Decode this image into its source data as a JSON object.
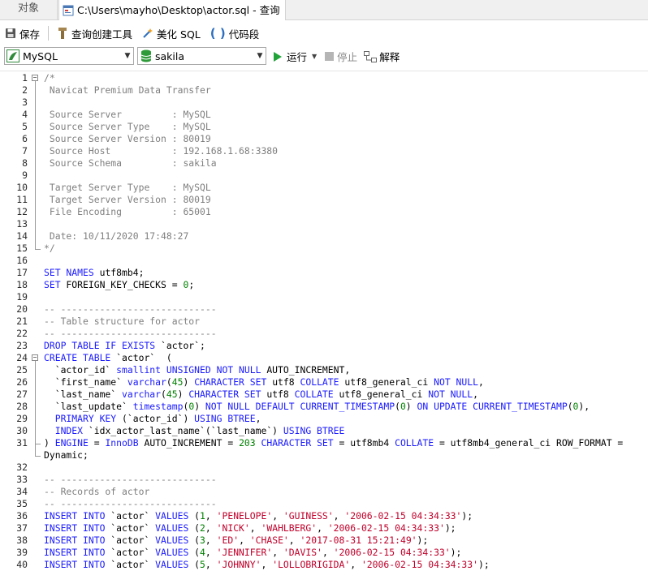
{
  "tabs": {
    "objects": "对象",
    "file": "C:\\Users\\mayho\\Desktop\\actor.sql - 查询"
  },
  "toolbar": {
    "save": "保存",
    "query_builder": "查询创建工具",
    "beautify": "美化 SQL",
    "snippet": "代码段"
  },
  "selectors": {
    "connection": "MySQL",
    "database": "sakila",
    "run": "运行",
    "stop": "停止",
    "explain": "解释"
  },
  "colors": {
    "comment": "#7f7f7f",
    "keyword": "#1a1aff",
    "string": "#c0002a",
    "number": "#008000"
  },
  "code_lines": [
    {
      "n": "1",
      "tokens": [
        [
          "c",
          "/*"
        ]
      ]
    },
    {
      "n": "2",
      "tokens": [
        [
          "c",
          " Navicat Premium Data Transfer"
        ]
      ]
    },
    {
      "n": "3",
      "tokens": []
    },
    {
      "n": "4",
      "tokens": [
        [
          "c",
          " Source Server         : MySQL"
        ]
      ]
    },
    {
      "n": "5",
      "tokens": [
        [
          "c",
          " Source Server Type    : MySQL"
        ]
      ]
    },
    {
      "n": "6",
      "tokens": [
        [
          "c",
          " Source Server Version : 80019"
        ]
      ]
    },
    {
      "n": "7",
      "tokens": [
        [
          "c",
          " Source Host           : 192.168.1.68:3380"
        ]
      ]
    },
    {
      "n": "8",
      "tokens": [
        [
          "c",
          " Source Schema         : sakila"
        ]
      ]
    },
    {
      "n": "9",
      "tokens": []
    },
    {
      "n": "10",
      "tokens": [
        [
          "c",
          " Target Server Type    : MySQL"
        ]
      ]
    },
    {
      "n": "11",
      "tokens": [
        [
          "c",
          " Target Server Version : 80019"
        ]
      ]
    },
    {
      "n": "12",
      "tokens": [
        [
          "c",
          " File Encoding         : 65001"
        ]
      ]
    },
    {
      "n": "13",
      "tokens": []
    },
    {
      "n": "14",
      "tokens": [
        [
          "c",
          " Date: 10/11/2020 17:48:27"
        ]
      ]
    },
    {
      "n": "15",
      "tokens": [
        [
          "c",
          "*/"
        ]
      ]
    },
    {
      "n": "16",
      "tokens": []
    },
    {
      "n": "17",
      "tokens": [
        [
          "k",
          "SET NAMES"
        ],
        [
          "t",
          " utf8mb4;"
        ]
      ]
    },
    {
      "n": "18",
      "tokens": [
        [
          "k",
          "SET"
        ],
        [
          "t",
          " FOREIGN_KEY_CHECKS = "
        ],
        [
          "n",
          "0"
        ],
        [
          "t",
          ";"
        ]
      ]
    },
    {
      "n": "19",
      "tokens": []
    },
    {
      "n": "20",
      "tokens": [
        [
          "c",
          "-- ----------------------------"
        ]
      ]
    },
    {
      "n": "21",
      "tokens": [
        [
          "c",
          "-- Table structure for actor"
        ]
      ]
    },
    {
      "n": "22",
      "tokens": [
        [
          "c",
          "-- ----------------------------"
        ]
      ]
    },
    {
      "n": "23",
      "tokens": [
        [
          "k",
          "DROP TABLE IF EXISTS"
        ],
        [
          "t",
          " `actor`;"
        ]
      ]
    },
    {
      "n": "24",
      "tokens": [
        [
          "k",
          "CREATE TABLE"
        ],
        [
          "t",
          " `actor`  ("
        ]
      ]
    },
    {
      "n": "25",
      "tokens": [
        [
          "t",
          "  `actor_id` "
        ],
        [
          "k",
          "smallint UNSIGNED NOT NULL"
        ],
        [
          "t",
          " AUTO_INCREMENT,"
        ]
      ]
    },
    {
      "n": "26",
      "tokens": [
        [
          "t",
          "  `first_name` "
        ],
        [
          "k",
          "varchar"
        ],
        [
          "t",
          "("
        ],
        [
          "n",
          "45"
        ],
        [
          "t",
          ") "
        ],
        [
          "k",
          "CHARACTER SET"
        ],
        [
          "t",
          " utf8 "
        ],
        [
          "k",
          "COLLATE"
        ],
        [
          "t",
          " utf8_general_ci "
        ],
        [
          "k",
          "NOT NULL"
        ],
        [
          "t",
          ","
        ]
      ]
    },
    {
      "n": "27",
      "tokens": [
        [
          "t",
          "  `last_name` "
        ],
        [
          "k",
          "varchar"
        ],
        [
          "t",
          "("
        ],
        [
          "n",
          "45"
        ],
        [
          "t",
          ") "
        ],
        [
          "k",
          "CHARACTER SET"
        ],
        [
          "t",
          " utf8 "
        ],
        [
          "k",
          "COLLATE"
        ],
        [
          "t",
          " utf8_general_ci "
        ],
        [
          "k",
          "NOT NULL"
        ],
        [
          "t",
          ","
        ]
      ]
    },
    {
      "n": "28",
      "tokens": [
        [
          "t",
          "  `last_update` "
        ],
        [
          "k",
          "timestamp"
        ],
        [
          "t",
          "("
        ],
        [
          "n",
          "0"
        ],
        [
          "t",
          ") "
        ],
        [
          "k",
          "NOT NULL DEFAULT CURRENT_TIMESTAMP"
        ],
        [
          "t",
          "("
        ],
        [
          "n",
          "0"
        ],
        [
          "t",
          ") "
        ],
        [
          "k",
          "ON UPDATE CURRENT_TIMESTAMP"
        ],
        [
          "t",
          "("
        ],
        [
          "n",
          "0"
        ],
        [
          "t",
          "),"
        ]
      ]
    },
    {
      "n": "29",
      "tokens": [
        [
          "k",
          "  PRIMARY KEY"
        ],
        [
          "t",
          " (`actor_id`) "
        ],
        [
          "k",
          "USING BTREE"
        ],
        [
          "t",
          ","
        ]
      ]
    },
    {
      "n": "30",
      "tokens": [
        [
          "k",
          "  INDEX"
        ],
        [
          "t",
          " `idx_actor_last_name`(`last_name`) "
        ],
        [
          "k",
          "USING BTREE"
        ]
      ]
    },
    {
      "n": "31",
      "tokens": [
        [
          "t",
          ") "
        ],
        [
          "k",
          "ENGINE"
        ],
        [
          "t",
          " = "
        ],
        [
          "k",
          "InnoDB"
        ],
        [
          "t",
          " AUTO_INCREMENT = "
        ],
        [
          "n",
          "203"
        ],
        [
          "t",
          " "
        ],
        [
          "k",
          "CHARACTER SET"
        ],
        [
          "t",
          " = utf8mb4 "
        ],
        [
          "k",
          "COLLATE"
        ],
        [
          "t",
          " = utf8mb4_general_ci ROW_FORMAT ="
        ]
      ]
    },
    {
      "n": "",
      "tokens": [
        [
          "t",
          "Dynamic;"
        ]
      ]
    },
    {
      "n": "32",
      "tokens": []
    },
    {
      "n": "33",
      "tokens": [
        [
          "c",
          "-- ----------------------------"
        ]
      ]
    },
    {
      "n": "34",
      "tokens": [
        [
          "c",
          "-- Records of actor"
        ]
      ]
    },
    {
      "n": "35",
      "tokens": [
        [
          "c",
          "-- ----------------------------"
        ]
      ]
    },
    {
      "n": "36",
      "tokens": [
        [
          "k",
          "INSERT INTO"
        ],
        [
          "t",
          " `actor` "
        ],
        [
          "k",
          "VALUES"
        ],
        [
          "t",
          " ("
        ],
        [
          "n",
          "1"
        ],
        [
          "t",
          ", "
        ],
        [
          "s",
          "'PENELOPE'"
        ],
        [
          "t",
          ", "
        ],
        [
          "s",
          "'GUINESS'"
        ],
        [
          "t",
          ", "
        ],
        [
          "s",
          "'2006-02-15 04:34:33'"
        ],
        [
          "t",
          ");"
        ]
      ]
    },
    {
      "n": "37",
      "tokens": [
        [
          "k",
          "INSERT INTO"
        ],
        [
          "t",
          " `actor` "
        ],
        [
          "k",
          "VALUES"
        ],
        [
          "t",
          " ("
        ],
        [
          "n",
          "2"
        ],
        [
          "t",
          ", "
        ],
        [
          "s",
          "'NICK'"
        ],
        [
          "t",
          ", "
        ],
        [
          "s",
          "'WAHLBERG'"
        ],
        [
          "t",
          ", "
        ],
        [
          "s",
          "'2006-02-15 04:34:33'"
        ],
        [
          "t",
          ");"
        ]
      ]
    },
    {
      "n": "38",
      "tokens": [
        [
          "k",
          "INSERT INTO"
        ],
        [
          "t",
          " `actor` "
        ],
        [
          "k",
          "VALUES"
        ],
        [
          "t",
          " ("
        ],
        [
          "n",
          "3"
        ],
        [
          "t",
          ", "
        ],
        [
          "s",
          "'ED'"
        ],
        [
          "t",
          ", "
        ],
        [
          "s",
          "'CHASE'"
        ],
        [
          "t",
          ", "
        ],
        [
          "s",
          "'2017-08-31 15:21:49'"
        ],
        [
          "t",
          ");"
        ]
      ]
    },
    {
      "n": "39",
      "tokens": [
        [
          "k",
          "INSERT INTO"
        ],
        [
          "t",
          " `actor` "
        ],
        [
          "k",
          "VALUES"
        ],
        [
          "t",
          " ("
        ],
        [
          "n",
          "4"
        ],
        [
          "t",
          ", "
        ],
        [
          "s",
          "'JENNIFER'"
        ],
        [
          "t",
          ", "
        ],
        [
          "s",
          "'DAVIS'"
        ],
        [
          "t",
          ", "
        ],
        [
          "s",
          "'2006-02-15 04:34:33'"
        ],
        [
          "t",
          ");"
        ]
      ]
    },
    {
      "n": "40",
      "tokens": [
        [
          "k",
          "INSERT INTO"
        ],
        [
          "t",
          " `actor` "
        ],
        [
          "k",
          "VALUES"
        ],
        [
          "t",
          " ("
        ],
        [
          "n",
          "5"
        ],
        [
          "t",
          ", "
        ],
        [
          "s",
          "'JOHNNY'"
        ],
        [
          "t",
          ", "
        ],
        [
          "s",
          "'LOLLOBRIGIDA'"
        ],
        [
          "t",
          ", "
        ],
        [
          "s",
          "'2006-02-15 04:34:33'"
        ],
        [
          "t",
          ");"
        ]
      ]
    }
  ]
}
